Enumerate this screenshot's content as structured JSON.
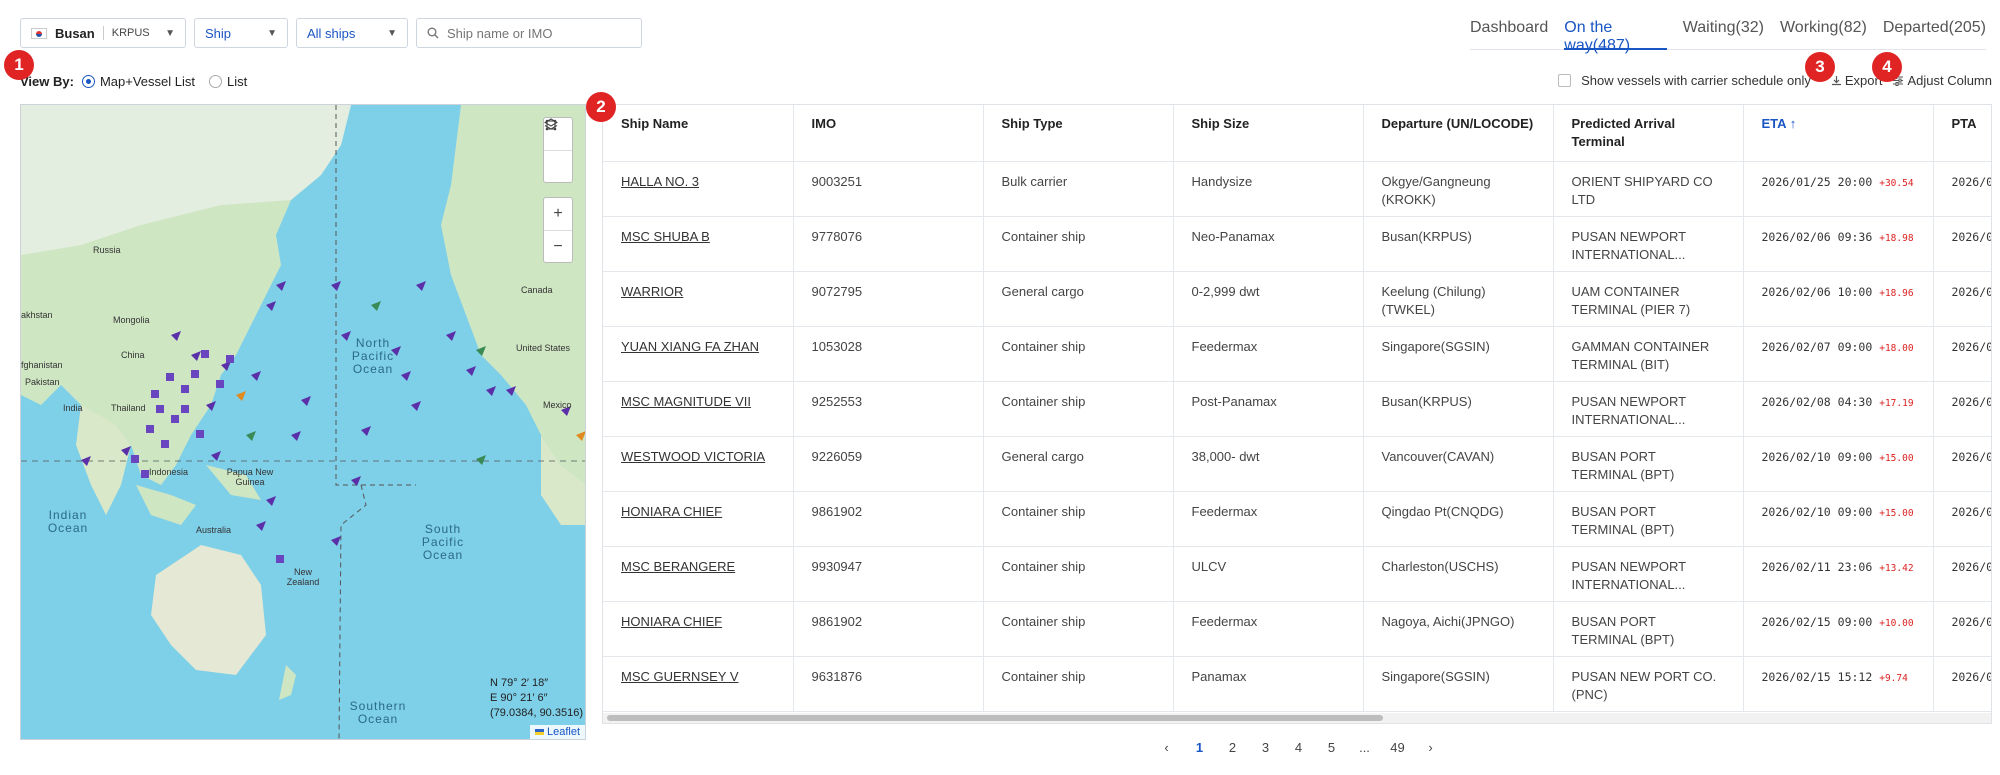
{
  "filters": {
    "port_name": "Busan",
    "port_code": "KRPUS",
    "ship_type": "Ship",
    "ship_scope": "All ships",
    "search_placeholder": "Ship name or IMO"
  },
  "tabs": [
    {
      "label": "Dashboard",
      "active": false
    },
    {
      "label": "On the way(487)",
      "active": true
    },
    {
      "label": "Waiting(32)",
      "active": false
    },
    {
      "label": "Working(82)",
      "active": false
    },
    {
      "label": "Departed(205)",
      "active": false
    }
  ],
  "badges": [
    "1",
    "2",
    "3",
    "4"
  ],
  "view_by": {
    "label": "View By:",
    "options": [
      {
        "label": "Map+Vessel List",
        "selected": true
      },
      {
        "label": "List",
        "selected": false
      }
    ]
  },
  "controls": {
    "carrier_schedule_label": "Show vessels with carrier schedule only",
    "export_label": "Export",
    "adjust_column_label": "Adjust Column"
  },
  "map": {
    "labels": {
      "russia": "Russia",
      "kazakhstan": "akhstan",
      "mongolia": "Mongolia",
      "china": "China",
      "afghanistan": "fghanistan",
      "pakistan": "Pakistan",
      "india": "India",
      "thailand": "Thailand",
      "indonesia": "Indonesia",
      "png": "Papua New Guinea",
      "australia": "Australia",
      "new_zealand": "New Zealand",
      "canada": "Canada",
      "united_states": "United States",
      "mexico": "Mexico"
    },
    "oceans": {
      "north_pacific": "North Pacific Ocean",
      "south_pacific": "South Pacific Ocean",
      "indian": "Indian Ocean",
      "southern": "Southern Ocean"
    },
    "coord_lat": "N 79° 2′ 18″",
    "coord_lon": "E 90° 21′ 6″",
    "coord_decimal": "(79.0384, 90.3516)",
    "attribution": "Leaflet",
    "zoom_in": "+",
    "zoom_out": "−"
  },
  "table": {
    "columns": [
      "Ship Name",
      "IMO",
      "Ship Type",
      "Ship Size",
      "Departure (UN/LOCODE)",
      "Predicted Arrival Terminal",
      "ETA",
      "PTA"
    ],
    "rows": [
      {
        "name": "HALLA NO. 3",
        "imo": "9003251",
        "type": "Bulk carrier",
        "size": "Handysize",
        "departure": "Okgye/Gangneung (KROKK)",
        "terminal": "ORIENT SHIPYARD CO LTD",
        "eta": "2026/01/25 20:00",
        "delay": "+30.54",
        "pta": "2026/0"
      },
      {
        "name": "MSC SHUBA B",
        "imo": "9778076",
        "type": "Container ship",
        "size": "Neo-Panamax",
        "departure": "Busan(KRPUS)",
        "terminal": "PUSAN NEWPORT INTERNATIONAL...",
        "eta": "2026/02/06 09:36",
        "delay": "+18.98",
        "pta": "2026/0"
      },
      {
        "name": "WARRIOR",
        "imo": "9072795",
        "type": "General cargo",
        "size": "0-2,999 dwt",
        "departure": "Keelung (Chilung)(TWKEL)",
        "terminal": "UAM CONTAINER TERMINAL (PIER 7)",
        "eta": "2026/02/06 10:00",
        "delay": "+18.96",
        "pta": "2026/0"
      },
      {
        "name": "YUAN XIANG FA ZHAN",
        "imo": "1053028",
        "type": "Container ship",
        "size": "Feedermax",
        "departure": "Singapore(SGSIN)",
        "terminal": "GAMMAN CONTAINER TERMINAL (BIT)",
        "eta": "2026/02/07 09:00",
        "delay": "+18.00",
        "pta": "2026/0"
      },
      {
        "name": "MSC MAGNITUDE VII",
        "imo": "9252553",
        "type": "Container ship",
        "size": "Post-Panamax",
        "departure": "Busan(KRPUS)",
        "terminal": "PUSAN NEWPORT INTERNATIONAL...",
        "eta": "2026/02/08 04:30",
        "delay": "+17.19",
        "pta": "2026/0"
      },
      {
        "name": "WESTWOOD VICTORIA",
        "imo": "9226059",
        "type": "General cargo",
        "size": "38,000- dwt",
        "departure": "Vancouver(CAVAN)",
        "terminal": "BUSAN PORT TERMINAL (BPT)",
        "eta": "2026/02/10 09:00",
        "delay": "+15.00",
        "pta": "2026/0"
      },
      {
        "name": "HONIARA CHIEF",
        "imo": "9861902",
        "type": "Container ship",
        "size": "Feedermax",
        "departure": "Qingdao Pt(CNQDG)",
        "terminal": "BUSAN PORT TERMINAL (BPT)",
        "eta": "2026/02/10 09:00",
        "delay": "+15.00",
        "pta": "2026/0"
      },
      {
        "name": "MSC BERANGERE",
        "imo": "9930947",
        "type": "Container ship",
        "size": "ULCV",
        "departure": "Charleston(USCHS)",
        "terminal": "PUSAN NEWPORT INTERNATIONAL...",
        "eta": "2026/02/11 23:06",
        "delay": "+13.42",
        "pta": "2026/0"
      },
      {
        "name": "HONIARA CHIEF",
        "imo": "9861902",
        "type": "Container ship",
        "size": "Feedermax",
        "departure": "Nagoya, Aichi(JPNGO)",
        "terminal": "BUSAN PORT TERMINAL (BPT)",
        "eta": "2026/02/15 09:00",
        "delay": "+10.00",
        "pta": "2026/0"
      },
      {
        "name": "MSC GUERNSEY V",
        "imo": "9631876",
        "type": "Container ship",
        "size": "Panamax",
        "departure": "Singapore(SGSIN)",
        "terminal": "PUSAN NEW PORT CO. (PNC)",
        "eta": "2026/02/15 15:12",
        "delay": "+9.74",
        "pta": "2026/0"
      }
    ]
  },
  "pagination": {
    "prev": "‹",
    "pages": [
      "1",
      "2",
      "3",
      "4",
      "5",
      "...",
      "49"
    ],
    "current": "1",
    "next": "›"
  },
  "colors": {
    "accent": "#1a55c4",
    "badge": "#e02424",
    "delay": "#d22222",
    "ocean": "#7ecfe8",
    "land": "#cfe6c3"
  }
}
